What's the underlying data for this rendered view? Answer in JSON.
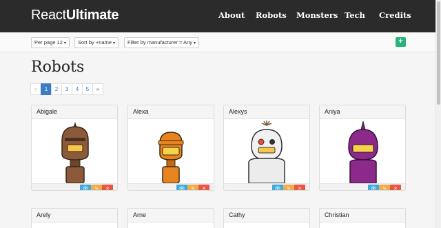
{
  "navbar": {
    "brand_prefix": "React",
    "brand_suffix": "Ultimate",
    "links": [
      "About",
      "Robots",
      "Monsters",
      "Tech",
      "Credits"
    ]
  },
  "toolbar": {
    "per_page": "Per page 12",
    "sort": "Sort by +name",
    "filter": "Filter by manufacturer = Any",
    "add": "+"
  },
  "page": {
    "title": "Robots"
  },
  "pagination": {
    "prev": "«",
    "pages": [
      "1",
      "2",
      "3",
      "4",
      "5"
    ],
    "next": "»",
    "active": "1"
  },
  "icons": {
    "view": "eye-icon",
    "edit": "edit-icon",
    "delete": "close-icon"
  },
  "robots": [
    {
      "name": "Abigale",
      "color": "#8a5a3a"
    },
    {
      "name": "Alexa",
      "color": "#e8841f"
    },
    {
      "name": "Alexys",
      "color": "#f1f1f1"
    },
    {
      "name": "Aniya",
      "color": "#8b2a8b"
    }
  ],
  "robots_row2": [
    "Arely",
    "Arne",
    "Cathy",
    "Christian"
  ],
  "colors": {
    "navbar": "#2b2b2b",
    "primary": "#3b7dc4",
    "success": "#2ab27b",
    "info": "#3fa9dd",
    "warning": "#f0ad4e",
    "danger": "#e9573f"
  }
}
